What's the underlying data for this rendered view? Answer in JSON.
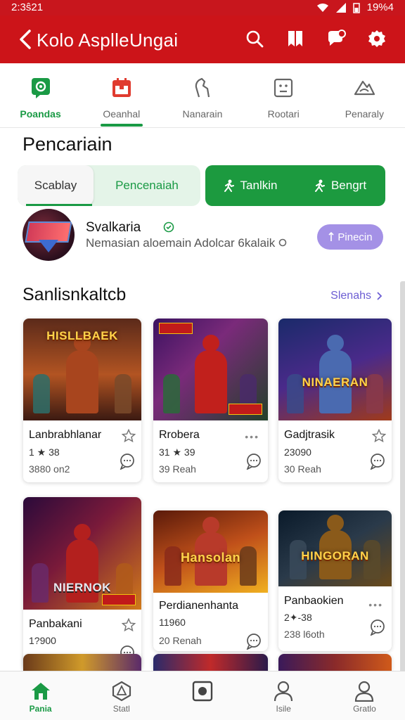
{
  "status_bar": {
    "time": "2:3ŝ21",
    "battery": "19%4"
  },
  "app_bar": {
    "title": "Kolo AsplleUngai"
  },
  "categories": [
    {
      "label": "Poandas",
      "active": true,
      "icon": "chat-bubble-icon"
    },
    {
      "label": "Oeanhal",
      "active": false,
      "icon": "calendar-icon"
    },
    {
      "label": "Nanarain",
      "active": false,
      "icon": "hand-icon"
    },
    {
      "label": "Rootari",
      "active": false,
      "icon": "face-icon"
    },
    {
      "label": "Penaraly",
      "active": false,
      "icon": "cloud-mountain-icon"
    }
  ],
  "section_title": "Pencariain",
  "segment": {
    "option1": "Scablay",
    "option2": "Pencenaiah"
  },
  "green_buttons": {
    "left": "Tanlkin",
    "right": "Bengrt"
  },
  "profile": {
    "name": "Svalkaria",
    "subtitle": "Nemasian aloemain Adolcar 6kalaik",
    "button": "Pinecin"
  },
  "list": {
    "heading": "Sanlisnkaltcb",
    "more": "Slenahs",
    "cards": [
      {
        "title": "Lanbrabhlanar",
        "line2": "1 ★ 38",
        "line3": "3880 on2",
        "banner": "HISLLBAEK",
        "corner": "star"
      },
      {
        "title": "Rrobera",
        "line2": "31 ★ 39",
        "line3": "39 Reah",
        "banner": "",
        "corner": "dots"
      },
      {
        "title": "Gadjtrasik",
        "line2": "23090",
        "line3": "30 Reah",
        "banner": "NINAERAN",
        "corner": "star"
      },
      {
        "title": "Panbakani",
        "line2": "1?900",
        "line3": "",
        "banner": "NIERNOK",
        "corner": "star"
      },
      {
        "title": "Perdianenhanta",
        "line2": "11960",
        "line3": "20 Renah",
        "banner": "Hansolan",
        "corner": "none"
      },
      {
        "title": "Panbaokien",
        "line2": "2✦-38",
        "line3": "238 l6oth",
        "banner": "HINGORAN",
        "corner": "dots"
      }
    ]
  },
  "bottom_nav": [
    {
      "label": "Pania",
      "active": true,
      "icon": "home-icon"
    },
    {
      "label": "Statl",
      "active": false,
      "icon": "hexagon-icon"
    },
    {
      "label": "",
      "active": false,
      "icon": "record-icon"
    },
    {
      "label": "Isile",
      "active": false,
      "icon": "person-icon"
    },
    {
      "label": "Gratlo",
      "active": false,
      "icon": "profile-icon"
    }
  ],
  "colors": {
    "brand_red": "#cc1419",
    "accent_green": "#1a9a45",
    "accent_purple": "#a491e6"
  }
}
